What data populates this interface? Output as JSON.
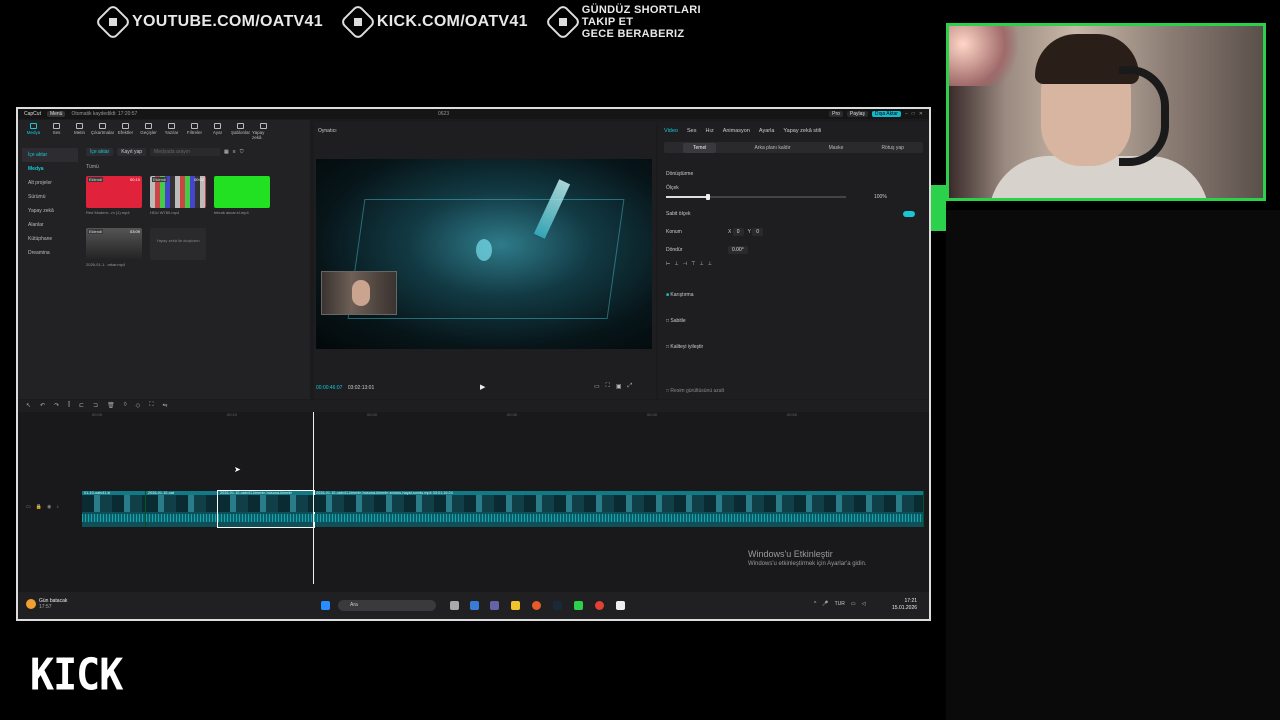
{
  "overlay": {
    "youtube": "YOUTUBE.COM/OATV41",
    "kick_url": "KICK.COM/OATV41",
    "promo": [
      "GÜNDÜZ SHORTLARI",
      "TAKIP ET",
      "GECE BERABERIZ"
    ],
    "logo_text": "KICK"
  },
  "titlebar": {
    "app": "CapCut",
    "menu": "Menü",
    "autosave": "Otomatik kaydedildi: 17:20:57",
    "project": "0623",
    "pro": "Pro",
    "share": "Paylaş",
    "export": "Dışa Aktar"
  },
  "toolbar": {
    "items": [
      "Medya",
      "Ses",
      "Metin",
      "Çıkartmalar",
      "Efektler",
      "Geçişler",
      "Yazılar",
      "Filtreler",
      "Ayar",
      "Şablonlar",
      "Yapay zekâ"
    ]
  },
  "media": {
    "import_btn": "İçe aktar",
    "record_btn": "Kayıt yap",
    "search_placeholder": "Medyada arayın",
    "all_label": "Tümü",
    "sidebar": [
      "İçe aktar",
      "Medya",
      "Alt projeler",
      "Sürümü",
      "Yapay zekâ",
      "Alanlar",
      "Kütüphane",
      "Dreamina"
    ],
    "thumbs": [
      {
        "tag": "Eklendi",
        "dur": "00:10",
        "label": "Red Modern...m (1).mp4",
        "color": "#e0223b"
      },
      {
        "tag": "Eklendi",
        "dur": "00:02",
        "label": "HDU W780.mp4",
        "color": "#777"
      },
      {
        "tag": "",
        "dur": "",
        "label": "tekrak akcar.el.mp4",
        "color": "#22e022"
      },
      {
        "tag": "Eklendi",
        "dur": "03:09",
        "label": "2026-01-1...mkar.mp4",
        "color": "#333"
      }
    ],
    "ai_tile": "Yapay zekâ ile oluşturun"
  },
  "player": {
    "title": "Oynatıcı",
    "time_current": "00:00:46:07",
    "time_total": "03:02:13:01"
  },
  "properties": {
    "tabs": [
      "Video",
      "Ses",
      "Hız",
      "Animasyon",
      "Ayarla",
      "Yapay zekâ stili"
    ],
    "subtabs": [
      "Temel",
      "Arka planı kaldır",
      "Maske",
      "Rötuş yap"
    ],
    "transform": "Dönüştürme",
    "scale": "Ölçek",
    "scale_value": "100%",
    "uniform": "Sabit ölçek",
    "position": "Konum",
    "pos_x": "0",
    "pos_y": "0",
    "rotate": "Döndür",
    "rotate_value": "0.00°",
    "blend": "Karıştırma",
    "stabilize": "Sabitle",
    "enhance": "Kaliteyi iyileştir",
    "noise": "Resim gürültüsünü azalt"
  },
  "timeline": {
    "ruler": [
      "00:00",
      "00:10",
      "00:20",
      "00:30",
      "00:40",
      "00:50"
    ],
    "clips": [
      "01-10-oatv41-kl",
      "2026-01-10-oat",
      "2026-01-10-oatv41-kimmin-hosuna-kimmin",
      "2026-01-10-oatv41-kimmin-hosuna-kimmin-zorunu-hayal-sundu.mp4   03:01:16:24"
    ]
  },
  "watermark": {
    "title": "Windows'u Etkinleştir",
    "subtitle": "Windows'u etkinleştirmek için Ayarlar'a gidin."
  },
  "taskbar": {
    "weather_title": "Gün batacak",
    "weather_time": "17:57",
    "search": "Ara",
    "lang": "TUR",
    "time": "17:21",
    "date": "15.01.2026"
  }
}
